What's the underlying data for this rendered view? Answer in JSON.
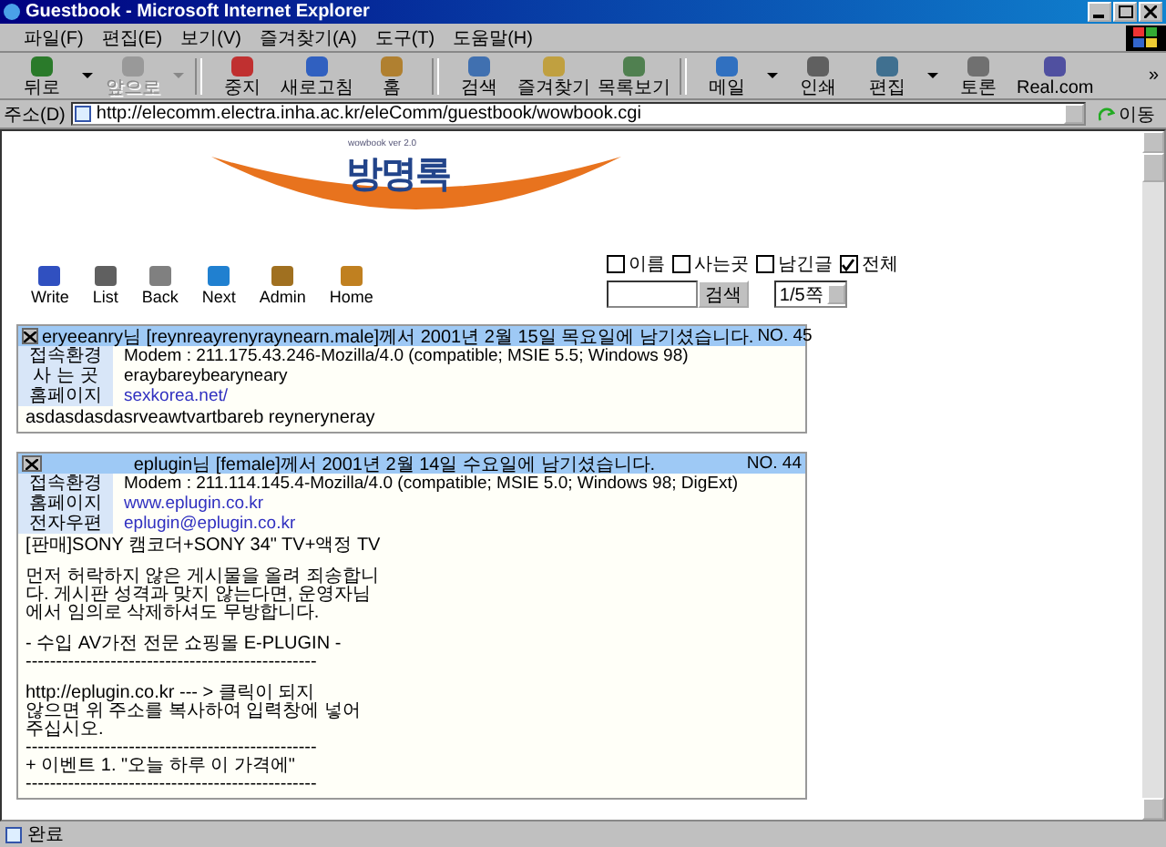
{
  "window": {
    "title": "Guestbook - Microsoft Internet Explorer"
  },
  "menu": [
    "파일(F)",
    "편집(E)",
    "보기(V)",
    "즐겨찾기(A)",
    "도구(T)",
    "도움말(H)"
  ],
  "toolbar": [
    {
      "label": "뒤로",
      "disabled": false,
      "dropdown": true
    },
    {
      "label": "앞으로",
      "disabled": true,
      "dropdown": true
    },
    {
      "label": "중지",
      "disabled": false,
      "dropdown": false
    },
    {
      "label": "새로고침",
      "disabled": false,
      "dropdown": false
    },
    {
      "label": "홈",
      "disabled": false,
      "dropdown": false
    },
    {
      "label": "검색",
      "disabled": false,
      "dropdown": false
    },
    {
      "label": "즐겨찾기",
      "disabled": false,
      "dropdown": false
    },
    {
      "label": "목록보기",
      "disabled": false,
      "dropdown": false
    },
    {
      "label": "메일",
      "disabled": false,
      "dropdown": true
    },
    {
      "label": "인쇄",
      "disabled": false,
      "dropdown": false
    },
    {
      "label": "편집",
      "disabled": false,
      "dropdown": true
    },
    {
      "label": "토론",
      "disabled": false,
      "dropdown": false
    },
    {
      "label": "Real.com",
      "disabled": false,
      "dropdown": false
    }
  ],
  "toolbar_more": "»",
  "address": {
    "label": "주소(D)",
    "value": "http://elecomm.electra.inha.ac.kr/eleComm/guestbook/wowbook.cgi",
    "go": "이동"
  },
  "logo": {
    "version": "wowbook ver 2.0",
    "title": "방명록"
  },
  "nav": [
    "Write",
    "List",
    "Back",
    "Next",
    "Admin",
    "Home"
  ],
  "search": {
    "options": [
      {
        "label": "이름",
        "checked": false
      },
      {
        "label": "사는곳",
        "checked": false
      },
      {
        "label": "남긴글",
        "checked": false
      },
      {
        "label": "전체",
        "checked": true
      }
    ],
    "button": "검색",
    "page": "1/5쪽"
  },
  "entries": [
    {
      "heading": "eryeeanry님 [reynreayrenyraynearn.male]께서 2001년 2월 15일 목요일에 남기셨습니다.",
      "no": "NO. 45",
      "fields": [
        {
          "label": "접속환경",
          "value": "Modem : 211.175.43.246-Mozilla/4.0 (compatible; MSIE 5.5; Windows 98)",
          "kind": "text"
        },
        {
          "label": "사 는 곳",
          "value": "eraybareybearyneary",
          "kind": "text"
        },
        {
          "label": "홈페이지",
          "value": "sexkorea.net/",
          "kind": "link"
        }
      ],
      "message": [
        "asdasdasdasrveawtvartbareb reyneryneray"
      ]
    },
    {
      "heading": "eplugin님 [female]께서 2001년 2월 14일 수요일에 남기셨습니다.",
      "no": "NO. 44",
      "fields": [
        {
          "label": "접속환경",
          "value": "Modem : 211.114.145.4-Mozilla/4.0 (compatible; MSIE 5.0; Windows 98; DigExt)",
          "kind": "text"
        },
        {
          "label": "홈페이지",
          "value": "www.eplugin.co.kr",
          "kind": "link"
        },
        {
          "label": "전자우편",
          "value": "eplugin@eplugin.co.kr",
          "kind": "link"
        }
      ],
      "message": [
        "[판매]SONY 캠코더+SONY 34\" TV+액정 TV",
        "먼저 허락하지 않은 게시물을 올려 죄송합니\n다. 게시판 성격과 맞지 않는다면, 운영자님\n에서 임의로 삭제하셔도 무방합니다.",
        "- 수입 AV가전 전문 쇼핑몰 E-PLUGIN -\n------------------------------------------------",
        "http://eplugin.co.kr --- > 클릭이 되지\n않으면 위 주소를 복사하여 입력창에 넣어\n주십시오.\n------------------------------------------------\n+ 이벤트 1. \"오늘 하루 이 가격에\"\n------------------------------------------------"
      ]
    }
  ],
  "status": "완료"
}
